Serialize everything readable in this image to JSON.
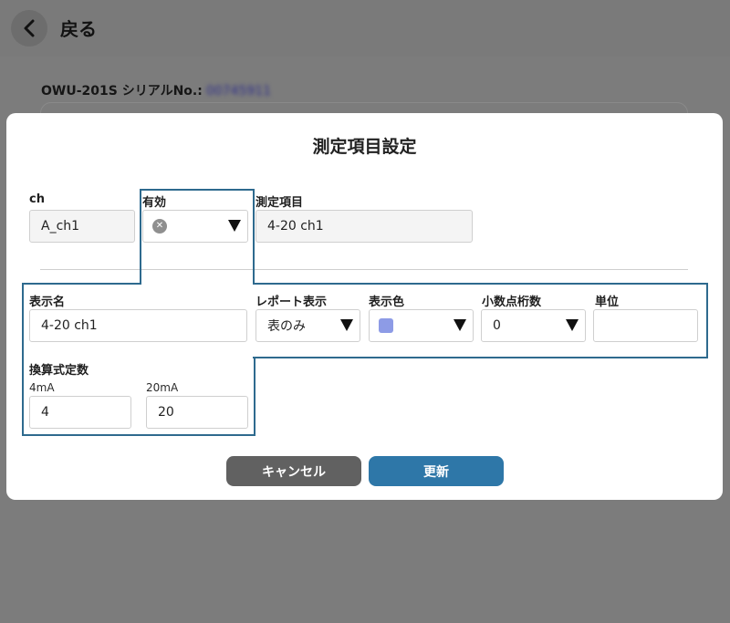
{
  "header": {
    "back_label": "戻る"
  },
  "device": {
    "serial_label": "OWU-201S シリアルNo.:",
    "serial_value": "00745911"
  },
  "modal": {
    "title": "測定項目設定",
    "ch": {
      "label": "ch",
      "value": "A_ch1"
    },
    "enabled": {
      "label": "有効"
    },
    "item": {
      "label": "測定項目",
      "value": "4-20 ch1"
    },
    "display_name": {
      "label": "表示名",
      "value": "4-20 ch1"
    },
    "report": {
      "label": "レポート表示",
      "value": "表のみ"
    },
    "color": {
      "label": "表示色",
      "value": "#8d9be6"
    },
    "decimals": {
      "label": "小数点桁数",
      "value": "0"
    },
    "unit": {
      "label": "単位",
      "value": ""
    },
    "conversion": {
      "label": "換算式定数",
      "low_label": "4mA",
      "low_value": "4",
      "high_label": "20mA",
      "high_value": "20"
    },
    "buttons": {
      "cancel": "キャンセル",
      "update": "更新"
    }
  },
  "colors": {
    "cancel_button": "#616161",
    "update_button": "#2e77a8",
    "highlight": "#2e6a8e"
  },
  "icons": {
    "back": "chevron-left-icon",
    "disabled": "x-circle-icon",
    "dropdown": "triangle-down-icon"
  }
}
